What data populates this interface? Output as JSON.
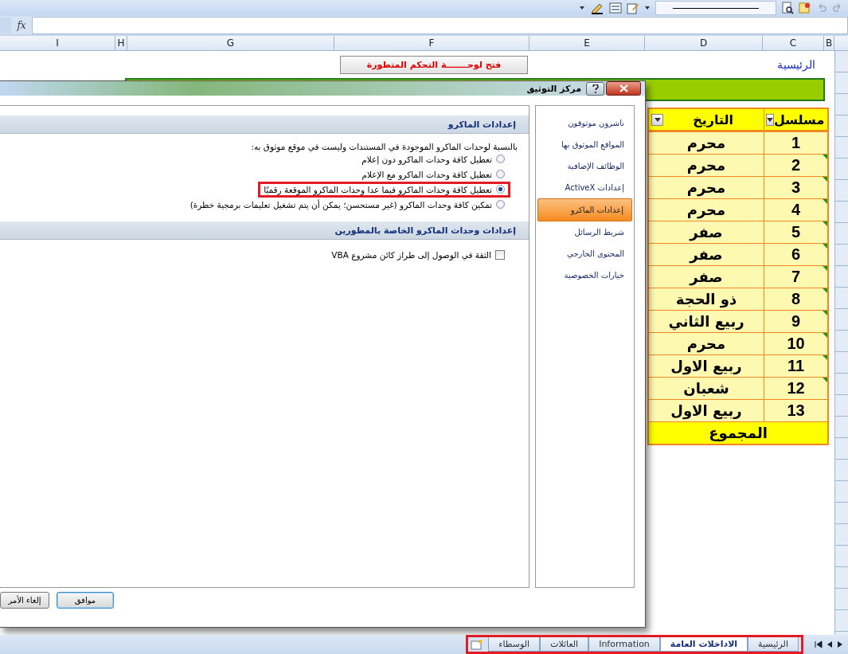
{
  "formula_bar": {
    "fx": "fx"
  },
  "columns": [
    "B",
    "C",
    "D",
    "E",
    "F",
    "G",
    "H",
    "I"
  ],
  "sheet": {
    "title": "الرئيسية",
    "panel_button": "فتح لوحـــــــة التحكم المتطورة",
    "table": {
      "columns": [
        "مسلسل",
        "التاريخ"
      ],
      "rows": [
        {
          "serial": "1",
          "month": "محرم",
          "flagged": false
        },
        {
          "serial": "2",
          "month": "محرم",
          "flagged": true
        },
        {
          "serial": "3",
          "month": "محرم",
          "flagged": true
        },
        {
          "serial": "4",
          "month": "محرم",
          "flagged": true
        },
        {
          "serial": "5",
          "month": "صفر",
          "flagged": true
        },
        {
          "serial": "6",
          "month": "صفر",
          "flagged": true
        },
        {
          "serial": "7",
          "month": "صفر",
          "flagged": true
        },
        {
          "serial": "8",
          "month": "ذو الحجة",
          "flagged": true
        },
        {
          "serial": "9",
          "month": "ربيع الثاني",
          "flagged": true
        },
        {
          "serial": "10",
          "month": "محرم",
          "flagged": true
        },
        {
          "serial": "11",
          "month": "ربيع الاول",
          "flagged": true
        },
        {
          "serial": "12",
          "month": "شعبان",
          "flagged": true
        },
        {
          "serial": "13",
          "month": "ربيع الاول",
          "flagged": false
        }
      ],
      "total": "المجموع"
    }
  },
  "dialog": {
    "title": "مركز التوثيق",
    "nav": [
      {
        "label": "ناشرون موثوقون",
        "selected": false
      },
      {
        "label": "المواقع الموثوق بها",
        "selected": false
      },
      {
        "label": "الوظائف الإضافية",
        "selected": false
      },
      {
        "label": "إعدادات ActiveX",
        "selected": false
      },
      {
        "label": "إعدادات الماكرو",
        "selected": true
      },
      {
        "label": "شريط الرسائل",
        "selected": false
      },
      {
        "label": "المحتوى الخارجي",
        "selected": false
      },
      {
        "label": "خيارات الخصوصية",
        "selected": false
      }
    ],
    "macro_section": {
      "heading": "إعدادات الماكرو",
      "intro": "بالنسبة لوحدات الماكرو الموجودة في المستندات وليست في موقع موثوق به:",
      "options": [
        {
          "label": "تعطيل كافة وحدات الماكرو دون إعلام",
          "selected": false,
          "annotated": false
        },
        {
          "label": "تعطيل كافة وحدات الماكرو مع الإعلام",
          "selected": false,
          "annotated": false
        },
        {
          "label": "تعطيل كافة وحدات الماكرو فيما عدا وحدات الماكرو الموقعة رقميًا",
          "selected": true,
          "annotated": true
        },
        {
          "label": "تمكين كافة وحدات الماكرو (غير مستحسن؛ يمكن أن يتم تشغيل تعليمات برمجية خطرة)",
          "selected": false,
          "annotated": false
        }
      ]
    },
    "developer_section": {
      "heading": "إعدادات وحدات الماكرو الخاصة بالمطورين",
      "checkbox": {
        "label": "الثقة في الوصول إلى طراز كائن مشروع VBA",
        "checked": false
      }
    },
    "buttons": [
      "موافق",
      "إلغاء الأمر"
    ]
  },
  "sheet_tabs": {
    "annotated": true,
    "tabs": [
      {
        "label": "الرئيسية",
        "selected": false
      },
      {
        "label": "الاداخلات العامة",
        "selected": true
      },
      {
        "label": "Information",
        "selected": false
      },
      {
        "label": "العائلات",
        "selected": false
      },
      {
        "label": "الوسطاء",
        "selected": false
      }
    ]
  }
}
